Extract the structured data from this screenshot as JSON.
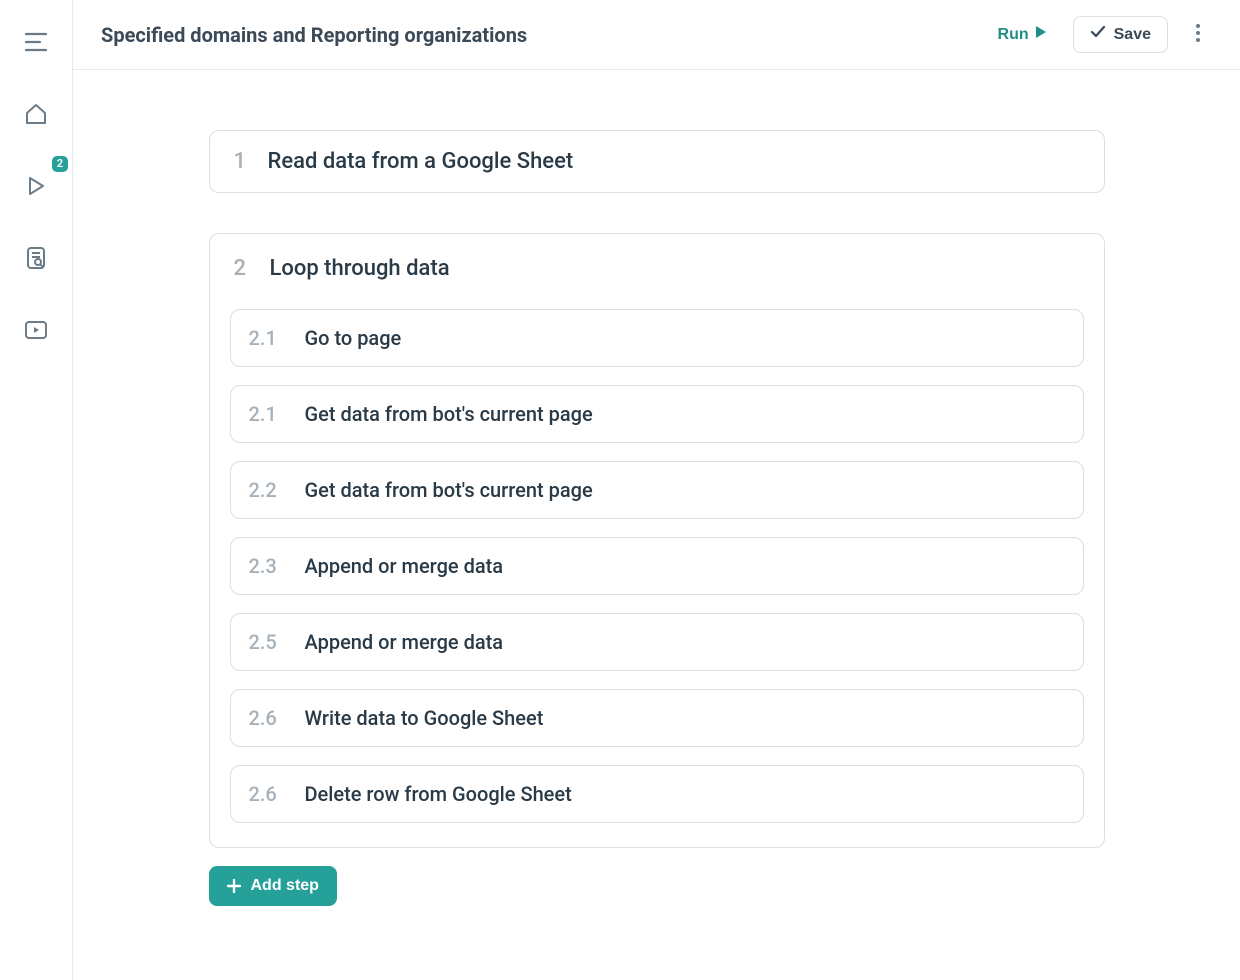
{
  "header": {
    "title": "Specified domains and Reporting organizations",
    "run_label": "Run",
    "save_label": "Save"
  },
  "sidebar": {
    "badge_count": "2"
  },
  "steps": [
    {
      "number": "1",
      "title": "Read data from a Google Sheet",
      "substeps": []
    },
    {
      "number": "2",
      "title": "Loop through data",
      "substeps": [
        {
          "number": "2.1",
          "title": "Go to page"
        },
        {
          "number": "2.1",
          "title": "Get data from bot's current page"
        },
        {
          "number": "2.2",
          "title": "Get data from bot's current page"
        },
        {
          "number": "2.3",
          "title": "Append or merge data"
        },
        {
          "number": "2.5",
          "title": "Append or merge data"
        },
        {
          "number": "2.6",
          "title": "Write data to Google Sheet"
        },
        {
          "number": "2.6",
          "title": "Delete row from Google Sheet"
        }
      ]
    }
  ],
  "buttons": {
    "add_step": "Add step"
  },
  "colors": {
    "accent": "#26a199",
    "accent_text": "#1f8f87",
    "text": "#2a3b47",
    "muted": "#a6b1b9",
    "border": "#d9dfe3"
  }
}
